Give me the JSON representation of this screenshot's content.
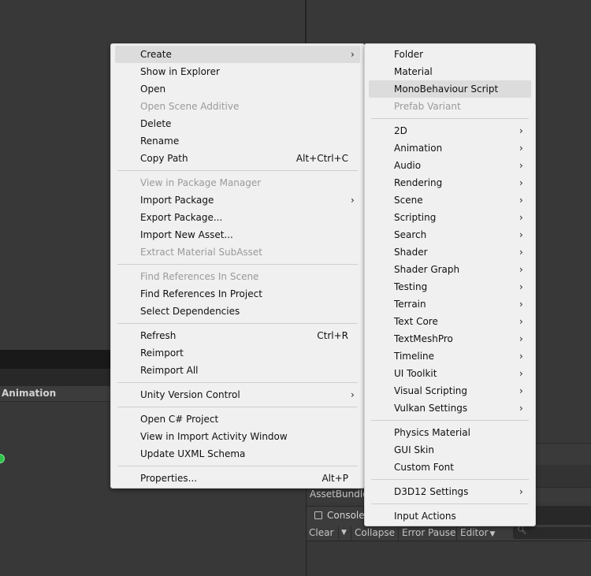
{
  "background": {
    "left_panel_header": "Animation",
    "assetbundle_label": "AssetBundle",
    "console_tab": "Console",
    "console_toolbar": {
      "clear": "Clear",
      "collapse": "Collapse",
      "error_pause": "Error Pause",
      "editor": "Editor"
    }
  },
  "context_menu": {
    "items": [
      {
        "label": "Create",
        "submenu": true,
        "highlighted": true
      },
      {
        "label": "Show in Explorer"
      },
      {
        "label": "Open"
      },
      {
        "label": "Open Scene Additive",
        "disabled": true
      },
      {
        "label": "Delete"
      },
      {
        "label": "Rename"
      },
      {
        "label": "Copy Path",
        "shortcut": "Alt+Ctrl+C"
      },
      {
        "label": "View in Package Manager",
        "disabled": true
      },
      {
        "label": "Import Package",
        "submenu": true
      },
      {
        "label": "Export Package..."
      },
      {
        "label": "Import New Asset..."
      },
      {
        "label": "Extract Material SubAsset",
        "disabled": true
      },
      {
        "label": "Find References In Scene",
        "disabled": true
      },
      {
        "label": "Find References In Project"
      },
      {
        "label": "Select Dependencies"
      },
      {
        "label": "Refresh",
        "shortcut": "Ctrl+R"
      },
      {
        "label": "Reimport"
      },
      {
        "label": "Reimport All"
      },
      {
        "label": "Unity Version Control",
        "submenu": true
      },
      {
        "label": "Open C# Project"
      },
      {
        "label": "View in Import Activity Window"
      },
      {
        "label": "Update UXML Schema"
      },
      {
        "label": "Properties...",
        "shortcut": "Alt+P"
      }
    ]
  },
  "create_submenu": {
    "items": [
      {
        "label": "Folder"
      },
      {
        "label": "Material"
      },
      {
        "label": "MonoBehaviour Script",
        "highlighted": true
      },
      {
        "label": "Prefab Variant",
        "disabled": true
      },
      {
        "label": "2D",
        "submenu": true
      },
      {
        "label": "Animation",
        "submenu": true
      },
      {
        "label": "Audio",
        "submenu": true
      },
      {
        "label": "Rendering",
        "submenu": true
      },
      {
        "label": "Scene",
        "submenu": true
      },
      {
        "label": "Scripting",
        "submenu": true
      },
      {
        "label": "Search",
        "submenu": true
      },
      {
        "label": "Shader",
        "submenu": true
      },
      {
        "label": "Shader Graph",
        "submenu": true
      },
      {
        "label": "Testing",
        "submenu": true
      },
      {
        "label": "Terrain",
        "submenu": true
      },
      {
        "label": "Text Core",
        "submenu": true
      },
      {
        "label": "TextMeshPro",
        "submenu": true
      },
      {
        "label": "Timeline",
        "submenu": true
      },
      {
        "label": "UI Toolkit",
        "submenu": true
      },
      {
        "label": "Visual Scripting",
        "submenu": true
      },
      {
        "label": "Vulkan Settings",
        "submenu": true
      },
      {
        "label": "Physics Material"
      },
      {
        "label": "GUI Skin"
      },
      {
        "label": "Custom Font"
      },
      {
        "label": "D3D12 Settings",
        "submenu": true
      },
      {
        "label": "Input Actions"
      }
    ]
  },
  "colors": {
    "editor_bg": "#383838",
    "menu_bg": "#f0f0f0",
    "menu_highlight": "#dcdcdc",
    "disabled_text": "#9a9a9a",
    "status_green": "#2ec24a"
  }
}
